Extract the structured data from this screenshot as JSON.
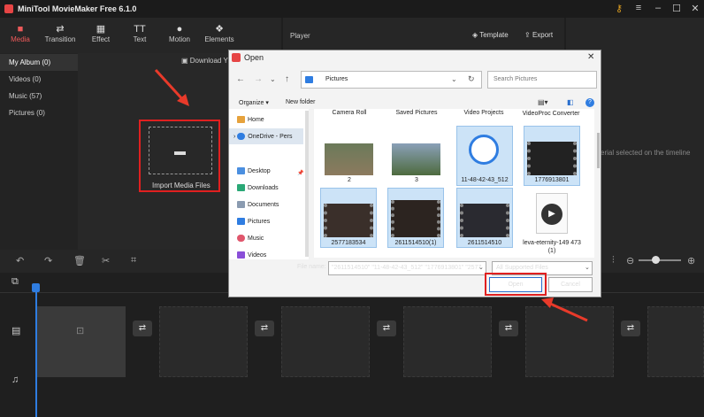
{
  "app": {
    "title": "MiniTool MovieMaker Free 6.1.0"
  },
  "toolbar": {
    "items": [
      {
        "label": "Media",
        "icon": "folder-icon"
      },
      {
        "label": "Transition",
        "icon": "swap-icon"
      },
      {
        "label": "Effect",
        "icon": "effect-icon"
      },
      {
        "label": "Text",
        "icon": "text-icon"
      },
      {
        "label": "Motion",
        "icon": "motion-icon"
      },
      {
        "label": "Elements",
        "icon": "elements-icon"
      }
    ]
  },
  "player": {
    "label": "Player",
    "template": "Template",
    "export": "Export"
  },
  "sidebar": {
    "items": [
      "My Album (0)",
      "Videos (0)",
      "Music (57)",
      "Pictures (0)"
    ]
  },
  "media": {
    "download": "Download Y",
    "import": "Import Media Files"
  },
  "right_panel": {
    "hint": "erial selected on the timeline"
  },
  "dialog": {
    "title": "Open",
    "breadcrumb": "Pictures",
    "search_placeholder": "Search Pictures",
    "organize": "Organize",
    "new_folder": "New folder",
    "nav": [
      "Home",
      "OneDrive - Pers",
      "Desktop",
      "Downloads",
      "Documents",
      "Pictures",
      "Music",
      "Videos"
    ],
    "top_labels": [
      "Camera Roll",
      "Saved Pictures",
      "Video Projects",
      "VideoProc Converter"
    ],
    "files": [
      {
        "name": "2",
        "selected": false
      },
      {
        "name": "3",
        "selected": false
      },
      {
        "name": "11-48-42-43_512",
        "selected": true
      },
      {
        "name": "1776913801",
        "selected": true
      },
      {
        "name": "2577183534",
        "selected": true
      },
      {
        "name": "2611514510(1)",
        "selected": true
      },
      {
        "name": "2611514510",
        "selected": true
      },
      {
        "name": "leva-eternity-149 473 (1)",
        "selected": false
      }
    ],
    "filename_label": "File name:",
    "filename_value": "\"2611514510\" \"11-48-42-43_512\" \"1776913801\" \"2577",
    "filter": "All Supported Files",
    "open": "Open",
    "cancel": "Cancel"
  },
  "colors": {
    "accent": "#ef5a5a",
    "highlight": "#e02020",
    "selection": "#cce3f7",
    "playhead": "#2f7de1"
  }
}
